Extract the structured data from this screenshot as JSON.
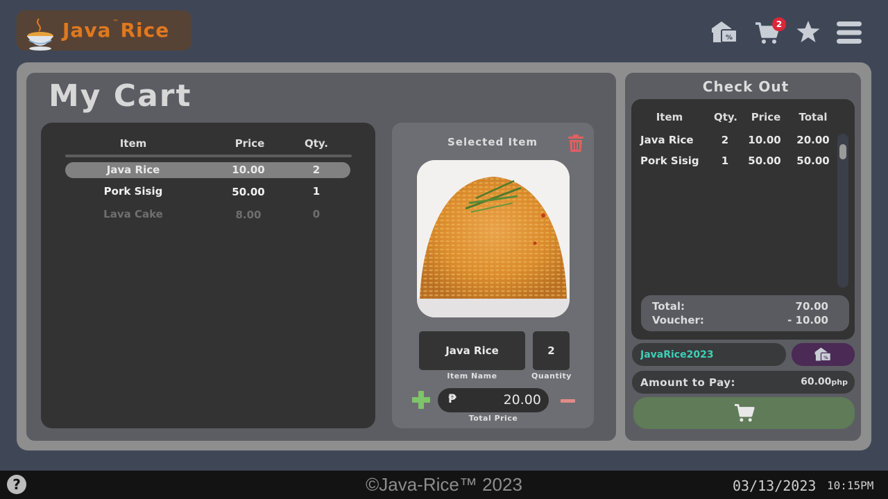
{
  "brand": {
    "name_part1": "Java",
    "tm": "™",
    "name_part2": "Rice"
  },
  "header": {
    "icons": [
      "voucher-icon",
      "cart-icon",
      "star-icon",
      "menu-icon"
    ],
    "cart_count": "2"
  },
  "page": {
    "title": "My Cart"
  },
  "cart_table": {
    "headers": {
      "item": "Item",
      "price": "Price",
      "qty": "Qty."
    },
    "rows": [
      {
        "name": "Java Rice",
        "price": "10.00",
        "qty": "2",
        "selected": true
      },
      {
        "name": "Pork Sisig",
        "price": "50.00",
        "qty": "1",
        "selected": false
      },
      {
        "name": "Lava Cake",
        "price": "8.00",
        "qty": "0",
        "selected": false
      }
    ]
  },
  "selected_item": {
    "title": "Selected Item",
    "name": "Java Rice",
    "quantity": "2",
    "name_caption": "Item Name",
    "quantity_caption": "Quantity",
    "currency_symbol": "₱",
    "total_price": "20.00",
    "total_caption": "Total Price"
  },
  "checkout": {
    "title": "Check Out",
    "headers": {
      "item": "Item",
      "qty": "Qty.",
      "price": "Price",
      "total": "Total"
    },
    "rows": [
      {
        "item": "Java Rice",
        "qty": "2",
        "price": "10.00",
        "total": "20.00"
      },
      {
        "item": "Pork Sisig",
        "qty": "1",
        "price": "50.00",
        "total": "50.00"
      }
    ],
    "total_label": "Total:",
    "total_value": "70.00",
    "voucher_label": "Voucher:",
    "voucher_value": "- 10.00",
    "voucher_code": "JavaRice2023",
    "amount_label": "Amount to Pay:",
    "amount_value": "60.00",
    "amount_unit": "php"
  },
  "footer": {
    "help": "?",
    "copyright": "©Java-Rice™ 2023",
    "date": "03/13/2023",
    "time": "10:15PM"
  },
  "colors": {
    "background": "#3f4757",
    "brand_orange": "#e0781e",
    "voucher_code": "#3ed0b6",
    "checkout_green": "#5f7b58",
    "badge_red": "#d9283a",
    "trash_red": "#e06060"
  }
}
